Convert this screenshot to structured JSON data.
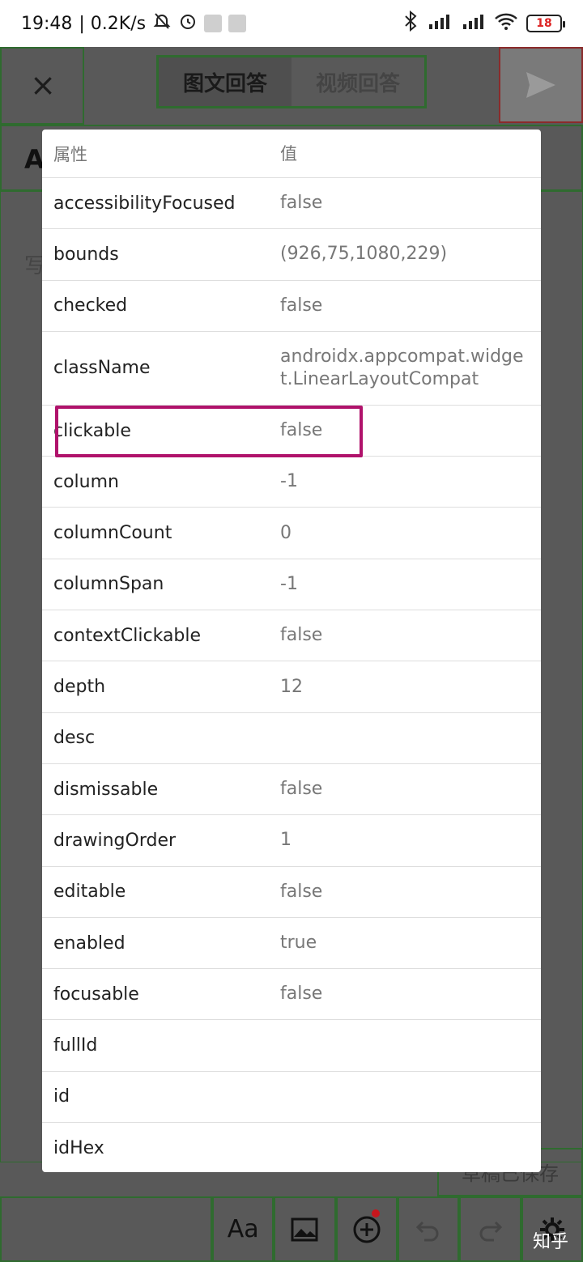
{
  "status_bar": {
    "time": "19:48",
    "net_speed": "| 0.2K/s",
    "battery": "18",
    "icons": [
      "mute-bell-icon",
      "alarm-icon",
      "bluetooth-icon",
      "signal-hd-icon",
      "signal-hd-icon",
      "wifi-icon",
      "battery-icon"
    ]
  },
  "background_app": {
    "close_icon": "×",
    "tabs": [
      "图文回答",
      "视频回答"
    ],
    "send_icon": "send-icon",
    "title_partial": "A",
    "body_partial": "写",
    "draft_saved": "草稿已保存",
    "toolbar": [
      "Aa",
      "image-icon",
      "add-icon",
      "undo-icon",
      "redo-icon",
      "settings-icon"
    ]
  },
  "dialog": {
    "header": {
      "name": "属性",
      "value": "值"
    },
    "rows": [
      {
        "name": "accessibilityFocused",
        "value": "false"
      },
      {
        "name": "bounds",
        "value": "(926,75,1080,229)"
      },
      {
        "name": "checked",
        "value": "false"
      },
      {
        "name": "className",
        "value": "androidx.appcompat.widget.LinearLayoutCompat"
      },
      {
        "name": "clickable",
        "value": "false"
      },
      {
        "name": "column",
        "value": "-1"
      },
      {
        "name": "columnCount",
        "value": "0"
      },
      {
        "name": "columnSpan",
        "value": "-1"
      },
      {
        "name": "contextClickable",
        "value": "false"
      },
      {
        "name": "depth",
        "value": "12"
      },
      {
        "name": "desc",
        "value": ""
      },
      {
        "name": "dismissable",
        "value": "false"
      },
      {
        "name": "drawingOrder",
        "value": "1"
      },
      {
        "name": "editable",
        "value": "false"
      },
      {
        "name": "enabled",
        "value": "true"
      },
      {
        "name": "focusable",
        "value": "false"
      },
      {
        "name": "fullId",
        "value": ""
      },
      {
        "name": "id",
        "value": ""
      },
      {
        "name": "idHex",
        "value": ""
      }
    ]
  },
  "watermark": "知乎"
}
